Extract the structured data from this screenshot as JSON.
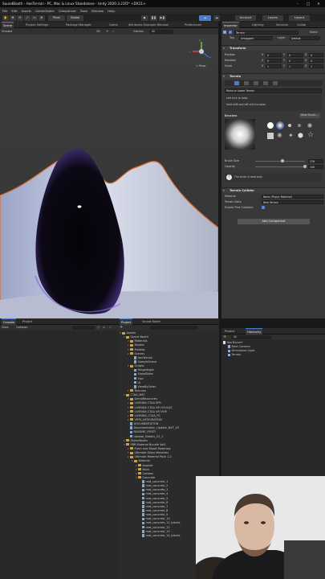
{
  "title_bar": {
    "text": "SoundBooth - HasTerrain - PC, Mac & Linux Standalone - Unity 2020.3.23f1* <DX11>",
    "minimize": "–",
    "maximize": "□",
    "close": "✕"
  },
  "menu": [
    "File",
    "Edit",
    "Assets",
    "GameObject",
    "Component",
    "Tools",
    "Window",
    "Help"
  ],
  "toolbar": {
    "pivot": "Pivot",
    "global": "Global",
    "account": "Account",
    "layers": "Layers",
    "layout": "Layout",
    "play": "▶",
    "pause": "❚❚",
    "step": "▶❚"
  },
  "scene_tabs": [
    "Scene",
    "Project Settings",
    "Package Manager",
    "Game",
    "Attributes Example Window",
    "Preferences"
  ],
  "scene_toolbar": {
    "shading": "Shaded",
    "mode": "2D",
    "gizmos": "Gizmos",
    "search": "All"
  },
  "gizmo": {
    "label": "< Persp",
    "x": "x",
    "y": "y",
    "z": "z"
  },
  "inspector": {
    "tabs": [
      "Inspector",
      "Lighting",
      "Services",
      "Collab"
    ],
    "object_name": "Terrain",
    "static_label": "Static",
    "tag_label": "Tag",
    "tag_value": "Untagged",
    "layer_label": "Layer",
    "layer_value": "Default",
    "transform": {
      "title": "Transform",
      "rows": [
        {
          "label": "Position",
          "x": "0",
          "y": "0",
          "z": "0"
        },
        {
          "label": "Rotation",
          "x": "0",
          "y": "0",
          "z": "0"
        },
        {
          "label": "Scale",
          "x": "1",
          "y": "1",
          "z": "1"
        }
      ],
      "axis_x": "X",
      "axis_y": "Y",
      "axis_z": "Z"
    },
    "terrain": {
      "title": "Terrain",
      "tool_dropdown": "Raise or Lower Terrain",
      "help1": "Left click to raise.",
      "help2": "Hold shift and left click to lower.",
      "brushes_label": "Brushes",
      "new_brush": "New Brush...",
      "brush_size_label": "Brush Size",
      "brush_size_value": "276",
      "brush_size_fraction": 0.55,
      "opacity_label": "Opacity",
      "opacity_value": "100",
      "opacity_fraction": 1.0,
      "readonly_note": "The brush is read only."
    },
    "collider": {
      "title": "Terrain Collider",
      "material_label": "Material",
      "material_value": "None (Physic Material)",
      "terrain_data_label": "Terrain Data",
      "terrain_data_value": "New Terrain",
      "trees_label": "Enable Tree Colliders",
      "trees_checked": "✓"
    },
    "add_component": "Add Component"
  },
  "console": {
    "tabs": [
      "Console",
      "Project"
    ],
    "clear": "Clear",
    "collapse": "Collapse"
  },
  "project": {
    "tabs": [
      "Project",
      "Sound Booth"
    ],
    "tree": [
      {
        "indent": 0,
        "kind": "folder",
        "label": "Assets"
      },
      {
        "indent": 1,
        "kind": "folder",
        "label": "Sound Booth"
      },
      {
        "indent": 2,
        "kind": "folder",
        "label": "Materials"
      },
      {
        "indent": 2,
        "kind": "folder",
        "label": "Models"
      },
      {
        "indent": 2,
        "kind": "folder",
        "label": "Prefabs"
      },
      {
        "indent": 2,
        "kind": "folder",
        "label": "Scenes"
      },
      {
        "indent": 3,
        "kind": "file",
        "label": "HasTerrain"
      },
      {
        "indent": 3,
        "kind": "file",
        "label": "SampleScene"
      },
      {
        "indent": 2,
        "kind": "folder",
        "label": "Scripts"
      },
      {
        "indent": 3,
        "kind": "file",
        "label": "HingeAngle"
      },
      {
        "indent": 3,
        "kind": "file",
        "label": "ShowSlider"
      },
      {
        "indent": 3,
        "kind": "file",
        "label": "Size"
      },
      {
        "indent": 3,
        "kind": "file",
        "label": "UI"
      },
      {
        "indent": 3,
        "kind": "file",
        "label": "ViewByOrder"
      },
      {
        "indent": 2,
        "kind": "folder",
        "label": "Textures"
      },
      {
        "indent": 1,
        "kind": "folder",
        "label": "CTAA_NXT"
      },
      {
        "indent": 2,
        "kind": "folder",
        "label": "DemoResources"
      },
      {
        "indent": 2,
        "kind": "folder",
        "label": "LIVENDA CTAA SPS"
      },
      {
        "indent": 2,
        "kind": "folder",
        "label": "LIVENDA CTAA VR OCULUS"
      },
      {
        "indent": 2,
        "kind": "folder",
        "label": "LIVENDA CTAA VR VIVE"
      },
      {
        "indent": 2,
        "kind": "folder",
        "label": "LIVENDA_CTAA_PC"
      },
      {
        "indent": 2,
        "kind": "folder",
        "label": "VRTK_INTEGRATION"
      },
      {
        "indent": 2,
        "kind": "file",
        "label": "DOCUMENTATION"
      },
      {
        "indent": 2,
        "kind": "file",
        "label": "Documentation_Update_NXT_V2"
      },
      {
        "indent": 2,
        "kind": "file",
        "label": "README_FIRST!"
      },
      {
        "indent": 2,
        "kind": "file",
        "label": "Update_Details_V2_1"
      },
      {
        "indent": 1,
        "kind": "folder",
        "label": "ObjectNotes"
      },
      {
        "indent": 1,
        "kind": "folder",
        "label": "PBR Material Bundle Vol1"
      },
      {
        "indent": 2,
        "kind": "folder",
        "label": "Flesh and Blood Materials"
      },
      {
        "indent": 2,
        "kind": "folder",
        "label": "Ultimate Glass Materials"
      },
      {
        "indent": 2,
        "kind": "folder",
        "label": "Ultimate Material Pack 1-2"
      },
      {
        "indent": 3,
        "kind": "folder",
        "label": "Material"
      },
      {
        "indent": 4,
        "kind": "folder",
        "label": "Asphalt"
      },
      {
        "indent": 4,
        "kind": "folder",
        "label": "Brick"
      },
      {
        "indent": 4,
        "kind": "folder",
        "label": "Cartoon"
      },
      {
        "indent": 4,
        "kind": "folder",
        "label": "Concrete"
      },
      {
        "indent": 5,
        "kind": "file",
        "label": "mat_concrete_1"
      },
      {
        "indent": 5,
        "kind": "file",
        "label": "mat_concrete_2"
      },
      {
        "indent": 5,
        "kind": "file",
        "label": "mat_concrete_3"
      },
      {
        "indent": 5,
        "kind": "file",
        "label": "mat_concrete_4"
      },
      {
        "indent": 5,
        "kind": "file",
        "label": "mat_concrete_5"
      },
      {
        "indent": 5,
        "kind": "file",
        "label": "mat_concrete_6"
      },
      {
        "indent": 5,
        "kind": "file",
        "label": "mat_concrete_7"
      },
      {
        "indent": 5,
        "kind": "file",
        "label": "mat_concrete_8"
      },
      {
        "indent": 5,
        "kind": "file",
        "label": "mat_concrete_9"
      },
      {
        "indent": 5,
        "kind": "file",
        "label": "mat_concrete_10"
      },
      {
        "indent": 5,
        "kind": "file",
        "label": "mat_concrete_11_blocks"
      },
      {
        "indent": 5,
        "kind": "file",
        "label": "mat_concrete_12"
      },
      {
        "indent": 5,
        "kind": "file",
        "label": "mat_concrete_13"
      },
      {
        "indent": 5,
        "kind": "file",
        "label": "mat_concrete_14_blocks"
      }
    ]
  },
  "hierarchy": {
    "tabs": [
      "Project",
      "Hierarchy"
    ],
    "search": "All",
    "items": [
      {
        "indent": 0,
        "label": "HasTerrain*"
      },
      {
        "indent": 1,
        "label": "Main Camera"
      },
      {
        "indent": 1,
        "label": "Directional Light"
      },
      {
        "indent": 1,
        "label": "Terrain"
      }
    ]
  }
}
